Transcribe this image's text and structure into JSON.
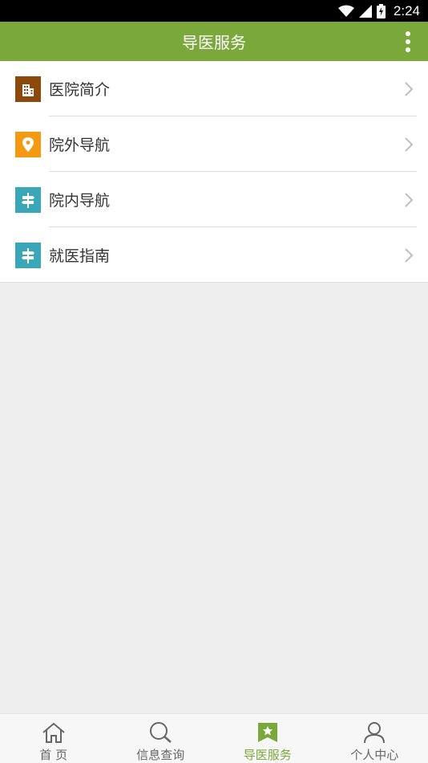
{
  "status_bar": {
    "time": "2:24"
  },
  "app_bar": {
    "title": "导医服务"
  },
  "menu": {
    "items": [
      {
        "label": "医院简介",
        "icon": "building-icon",
        "color": "#8b4a0c"
      },
      {
        "label": "院外导航",
        "icon": "location-pin-icon",
        "color": "#f39a12"
      },
      {
        "label": "院内导航",
        "icon": "signpost-icon",
        "color": "#3aa7b8"
      },
      {
        "label": "就医指南",
        "icon": "signpost-icon",
        "color": "#3aa7b8"
      }
    ]
  },
  "tab_bar": {
    "tabs": [
      {
        "label": "首 页",
        "icon": "home-icon",
        "active": false
      },
      {
        "label": "信息查询",
        "icon": "search-icon",
        "active": false
      },
      {
        "label": "导医服务",
        "icon": "bookmark-star-icon",
        "active": true
      },
      {
        "label": "个人中心",
        "icon": "person-icon",
        "active": false
      }
    ],
    "active_color": "#7aa83b",
    "inactive_color": "#666666"
  },
  "colors": {
    "app_bar": "#7aa83b",
    "background": "#eeeeee"
  }
}
